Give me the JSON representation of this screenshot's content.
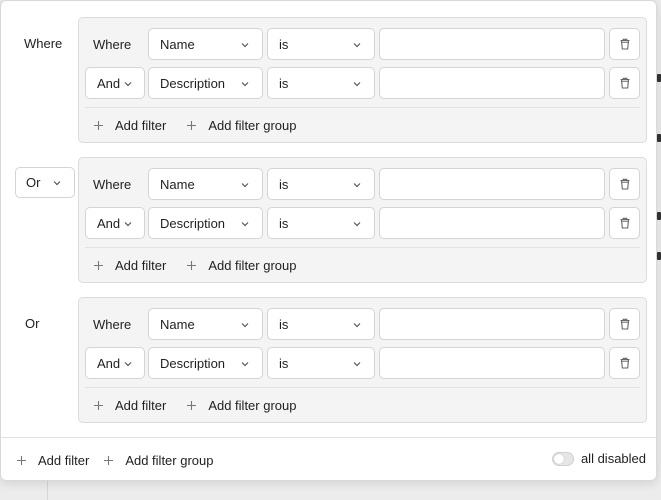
{
  "groups": [
    {
      "conjunction": "Where",
      "conjunction_type": "label",
      "rules": [
        {
          "prefix": "Where",
          "property": "Name",
          "operator": "is",
          "value": ""
        },
        {
          "prefix": "And",
          "property": "Description",
          "operator": "is",
          "value": ""
        }
      ],
      "add_filter": "Add filter",
      "add_filter_group": "Add filter group"
    },
    {
      "conjunction": "Or",
      "conjunction_type": "select",
      "rules": [
        {
          "prefix": "Where",
          "property": "Name",
          "operator": "is",
          "value": ""
        },
        {
          "prefix": "And",
          "property": "Description",
          "operator": "is",
          "value": ""
        }
      ],
      "add_filter": "Add filter",
      "add_filter_group": "Add filter group"
    },
    {
      "conjunction": "Or",
      "conjunction_type": "label",
      "rules": [
        {
          "prefix": "Where",
          "property": "Name",
          "operator": "is",
          "value": ""
        },
        {
          "prefix": "And",
          "property": "Description",
          "operator": "is",
          "value": ""
        }
      ],
      "add_filter": "Add filter",
      "add_filter_group": "Add filter group"
    }
  ],
  "footer": {
    "add_filter": "Add filter",
    "add_filter_group": "Add filter group",
    "toggle_label": "all disabled",
    "toggle_on": false
  },
  "icons": {
    "chevron": "chevron-down-icon",
    "trash": "trash-icon",
    "plus": "plus-icon"
  }
}
